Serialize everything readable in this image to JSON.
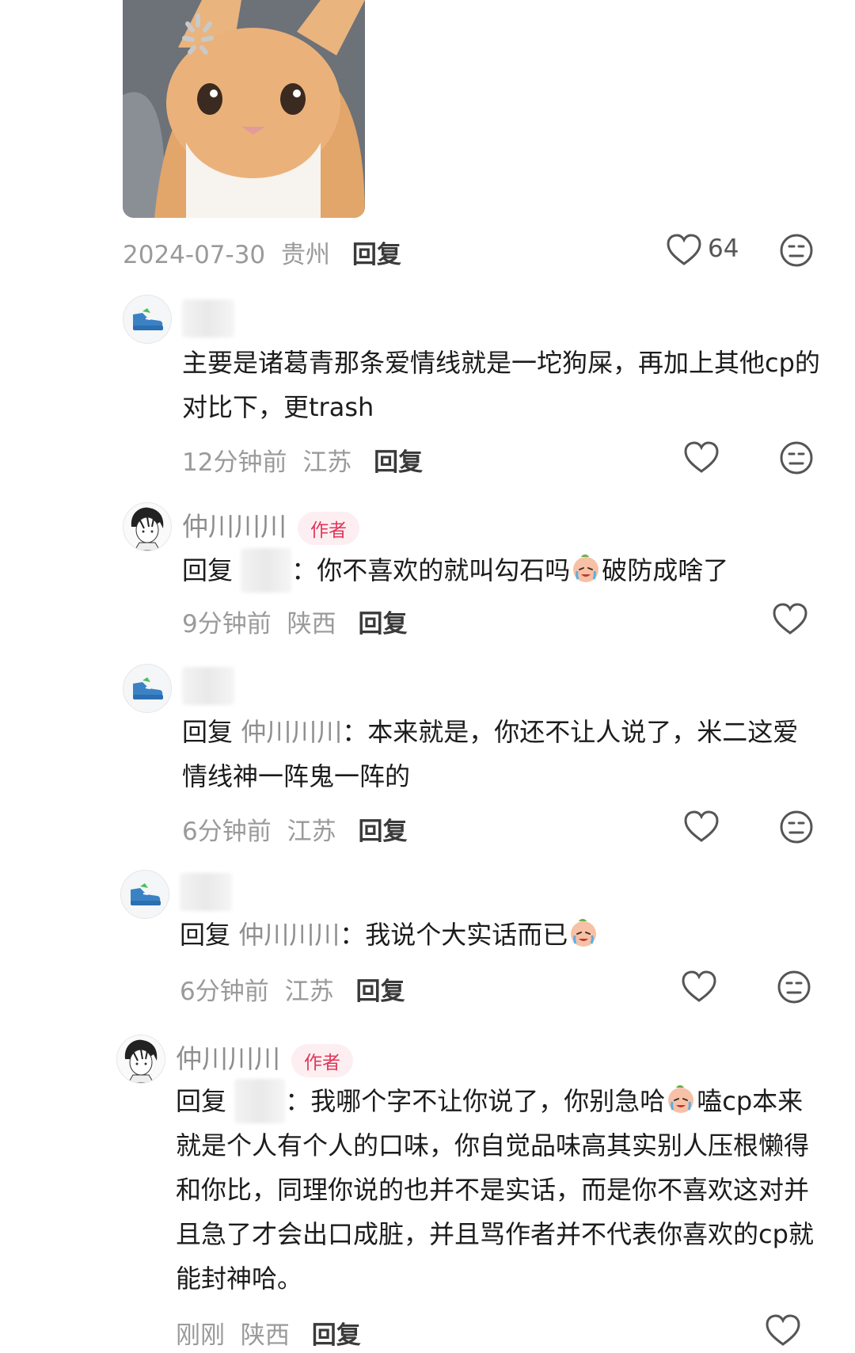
{
  "top_post": {
    "meta": {
      "date": "2024-07-30",
      "location": "贵州",
      "reply": "回复"
    },
    "like_count": "64"
  },
  "comments": [
    {
      "username": "",
      "text": "主要是诸葛青那条爱情线就是一坨狗屎，再加上其他cp的对比下，更trash",
      "time": "12分钟前",
      "location": "江苏",
      "reply": "回复"
    },
    {
      "username": "仲川川川",
      "badge": "作者",
      "reply_prefix": "回复",
      "reply_to": "",
      "colon": "：",
      "text_a": "你不喜欢的就叫勾石吗",
      "text_b": "破防成啥了",
      "time": "9分钟前",
      "location": "陕西",
      "reply": "回复"
    },
    {
      "username": "",
      "reply_prefix": "回复",
      "reply_to": "仲川川川",
      "colon": "：",
      "text": "本来就是，你还不让人说了，米二这爱情线神一阵鬼一阵的",
      "time": "6分钟前",
      "location": "江苏",
      "reply": "回复"
    },
    {
      "username": "",
      "reply_prefix": "回复",
      "reply_to": "仲川川川",
      "colon": "：",
      "text": "我说个大实话而已",
      "time": "6分钟前",
      "location": "江苏",
      "reply": "回复"
    },
    {
      "username": "仲川川川",
      "badge": "作者",
      "reply_prefix": "回复",
      "reply_to": "",
      "colon": "：",
      "text_a": "我哪个字不让你说了，你别急哈",
      "text_b": "嗑cp本来就是个人有个人的口味，你自觉品味高其实别人压根懒得和你比，同理你说的也并不是实话，而是你不喜欢这对并且急了才会出口成脏，并且骂作者并不代表你喜欢的cp就能封神哈。",
      "time": "刚刚",
      "location": "陕西",
      "reply": "回复"
    }
  ],
  "icons": {
    "like": "heart-outline-icon",
    "dislike": "meh-face-icon",
    "avatar_fan": "green-sneaker-icon",
    "avatar_author": "manga-boy-avatar",
    "emoji": "crying-face-emoji"
  }
}
